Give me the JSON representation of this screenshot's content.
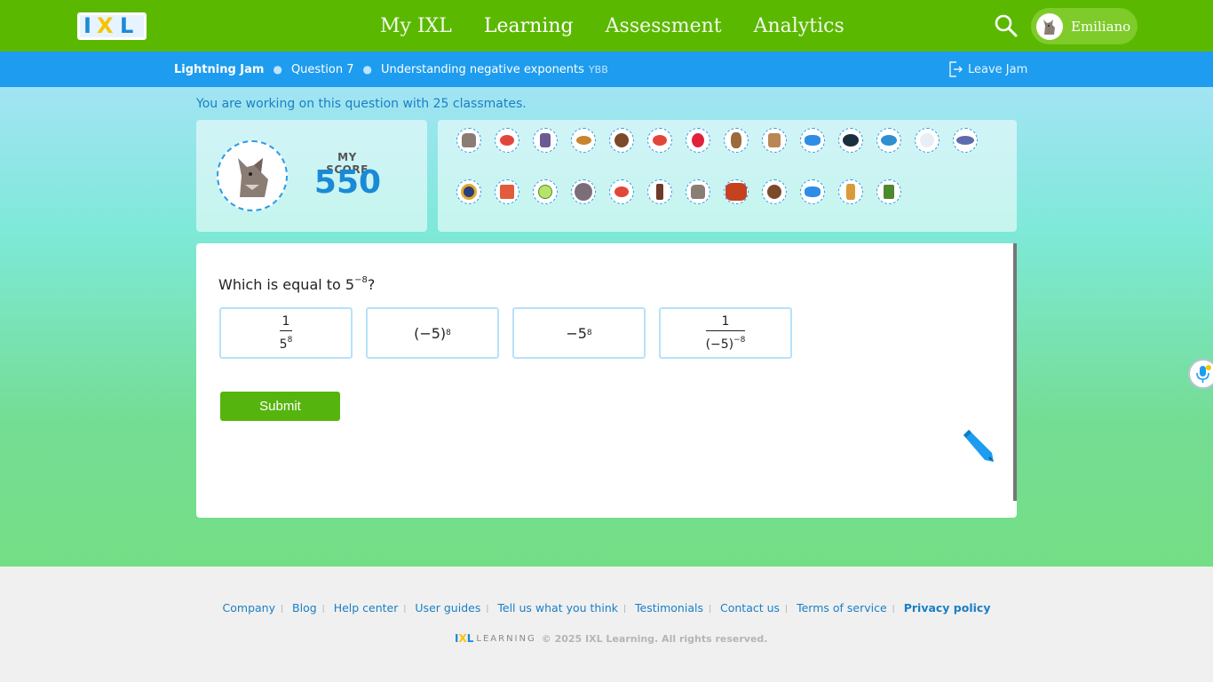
{
  "nav": {
    "logo_letters": [
      "I",
      "X",
      "L"
    ],
    "links": [
      "My IXL",
      "Learning",
      "Assessment",
      "Analytics"
    ],
    "user_name": "Emiliano"
  },
  "subbar": {
    "jam": "Lightning Jam",
    "question": "Question 7",
    "skill": "Understanding negative exponents",
    "skill_code": "YBB",
    "leave": "Leave Jam"
  },
  "classmates_text": "You are working on this question with 25 classmates.",
  "score": {
    "label": "MY SCORE",
    "value": "550"
  },
  "question": {
    "prefix": "Which is equal to 5",
    "exponent": "−8",
    "suffix": "?",
    "choices": [
      {
        "num": "1",
        "den_base": "5",
        "den_exp": "8"
      },
      {
        "base": "(−5)",
        "exp": "8"
      },
      {
        "base": "−5",
        "exp": "8"
      },
      {
        "num": "1",
        "den_base": "(−5)",
        "den_exp": "−8"
      }
    ],
    "submit": "Submit"
  },
  "footer": {
    "links": [
      "Company",
      "Blog",
      "Help center",
      "User guides",
      "Tell us what you think",
      "Testimonials",
      "Contact us",
      "Terms of service",
      "Privacy policy"
    ],
    "logo_learning": "LEARNING",
    "copyright": "© 2025 IXL Learning. All rights reserved."
  },
  "colors": {
    "nav_green": "#5bb800",
    "sub_blue": "#1e9cef",
    "score_blue": "#1a8ad6",
    "submit_green": "#56b40e"
  },
  "icons": {
    "search": "search-icon",
    "leave": "exit-icon",
    "pencil": "pencil-icon",
    "mic": "microphone-icon"
  }
}
